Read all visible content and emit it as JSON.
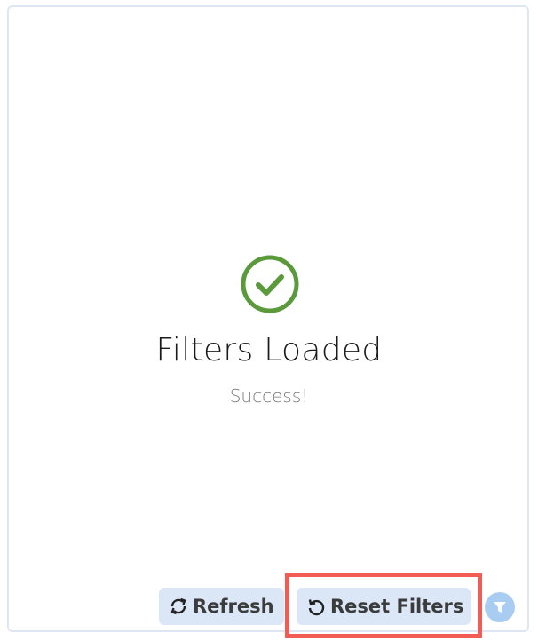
{
  "status": {
    "icon": "check-circle-icon",
    "title": "Filters Loaded",
    "message": "Success!",
    "color": "#5a9a3a"
  },
  "actions": {
    "refresh_label": "Refresh",
    "refresh_icon": "refresh-icon",
    "reset_label": "Reset Filters",
    "reset_icon": "reset-icon",
    "filter_icon": "filter-icon"
  },
  "colors": {
    "button_bg": "#dbe7f7",
    "filter_button_bg": "#a9cdf2",
    "highlight_border": "#f25c54"
  }
}
